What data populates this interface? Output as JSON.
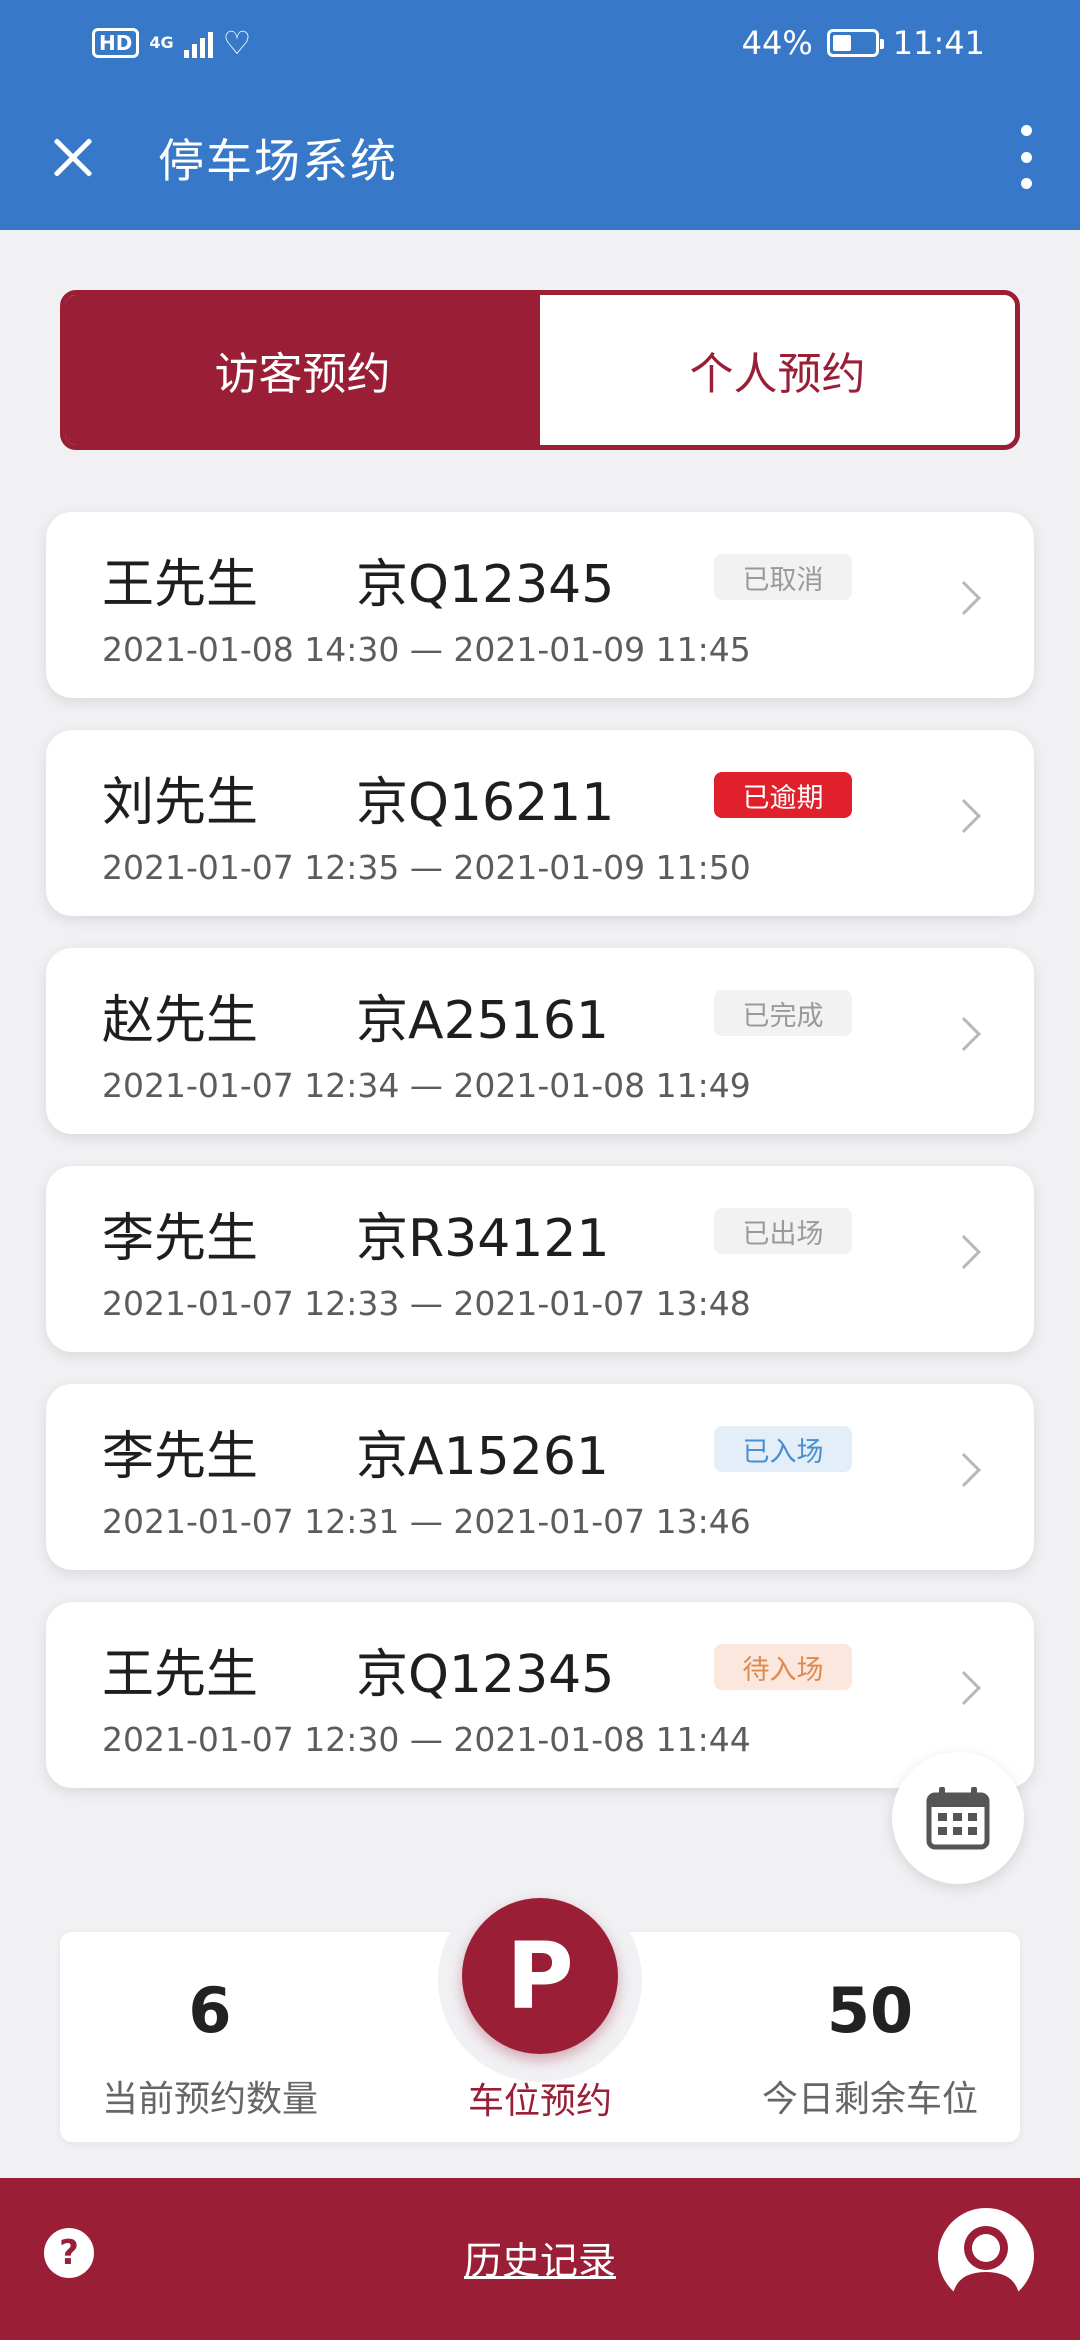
{
  "status_bar": {
    "hd": "HD",
    "network": "4G",
    "battery_percent": "44%",
    "battery_level": 0.44,
    "time": "11:41"
  },
  "header": {
    "title": "停车场系统",
    "close_icon": "close-icon",
    "more_icon": "more-vertical-icon"
  },
  "tabs": [
    {
      "label": "访客预约",
      "active": true
    },
    {
      "label": "个人预约",
      "active": false
    }
  ],
  "reservations": [
    {
      "name": "王先生",
      "plate": "京Q12345",
      "status": "已取消",
      "status_bg": "#f2f2f2",
      "status_fg": "#9a9a9a",
      "time": "2021-01-08 14:30 — 2021-01-09 11:45"
    },
    {
      "name": "刘先生",
      "plate": "京Q16211",
      "status": "已逾期",
      "status_bg": "#e0202a",
      "status_fg": "#ffffff",
      "time": "2021-01-07 12:35 — 2021-01-09 11:50"
    },
    {
      "name": "赵先生",
      "plate": "京A25161",
      "status": "已完成",
      "status_bg": "#f2f2f2",
      "status_fg": "#9a9a9a",
      "time": "2021-01-07 12:34 — 2021-01-08 11:49"
    },
    {
      "name": "李先生",
      "plate": "京R34121",
      "status": "已出场",
      "status_bg": "#f2f2f2",
      "status_fg": "#9a9a9a",
      "time": "2021-01-07 12:33 — 2021-01-07 13:48"
    },
    {
      "name": "李先生",
      "plate": "京A15261",
      "status": "已入场",
      "status_bg": "#e3eef9",
      "status_fg": "#4a8fcf",
      "time": "2021-01-07 12:31 — 2021-01-07 13:46"
    },
    {
      "name": "王先生",
      "plate": "京Q12345",
      "status": "待入场",
      "status_bg": "#fbe7dd",
      "status_fg": "#e0894f",
      "time": "2021-01-07 12:30 — 2021-01-08 11:44"
    }
  ],
  "summary": {
    "current_count": "6",
    "current_label": "当前预约数量",
    "reserve_icon": "P",
    "reserve_label": "车位预约",
    "remaining_count": "50",
    "remaining_label": "今日剩余车位"
  },
  "bottom": {
    "help_icon": "?",
    "history_label": "历史记录",
    "profile_icon": "profile-icon"
  },
  "colors": {
    "primary_blue": "#3778c8",
    "brand_red": "#9a1f36"
  }
}
